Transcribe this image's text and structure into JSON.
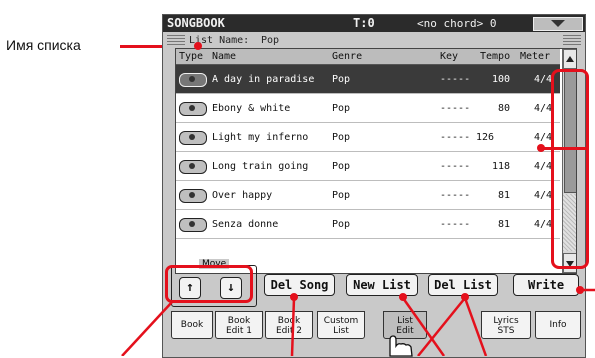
{
  "annotation": {
    "list_name_label": "Имя списка"
  },
  "titlebar": {
    "app": "SONGBOOK",
    "tempo": "T:0",
    "chord": "<no chord> 0"
  },
  "list_name": {
    "label": "List Name:",
    "value": "Pop"
  },
  "columns": [
    "Type",
    "Name",
    "Genre",
    "Key",
    "Tempo",
    "Meter"
  ],
  "rows": [
    {
      "name": "A day in paradise",
      "genre": "Pop",
      "key": "-----",
      "tempo": "100",
      "meter": "4/4",
      "selected": true
    },
    {
      "name": "Ebony & white",
      "genre": "Pop",
      "key": "-----",
      "tempo": "80",
      "meter": "4/4",
      "selected": false
    },
    {
      "name": "Light my inferno",
      "genre": "Pop",
      "key": "-----",
      "tempo": "126",
      "meter": "4/4",
      "selected": false
    },
    {
      "name": "Long train going",
      "genre": "Pop",
      "key": "-----",
      "tempo": "118",
      "meter": "4/4",
      "selected": false
    },
    {
      "name": "Over happy",
      "genre": "Pop",
      "key": "-----",
      "tempo": "81",
      "meter": "4/4",
      "selected": false
    },
    {
      "name": "Senza donne",
      "genre": "Pop",
      "key": "-----",
      "tempo": "81",
      "meter": "4/4",
      "selected": false
    }
  ],
  "move": {
    "label": "Move",
    "up": "↑",
    "down": "↓"
  },
  "buttons": {
    "del_song": "Del Song",
    "new_list": "New List",
    "del_list": "Del List",
    "write": "Write"
  },
  "tabs": [
    {
      "line1": "Book",
      "line2": ""
    },
    {
      "line1": "Book",
      "line2": "Edit 1"
    },
    {
      "line1": "Book",
      "line2": "Edit 2"
    },
    {
      "line1": "Custom",
      "line2": "List"
    },
    {
      "line1": "List",
      "line2": "Edit"
    },
    {
      "line1": "Lyrics",
      "line2": "STS"
    },
    {
      "line1": "Info",
      "line2": ""
    }
  ],
  "colors": {
    "annotation_red": "#e4101c",
    "screen_bg": "#c9c9c9",
    "selected_row": "#3a3a3a"
  },
  "icons": {
    "song_type": "disk-icon",
    "hand": "pointing-hand-icon"
  }
}
